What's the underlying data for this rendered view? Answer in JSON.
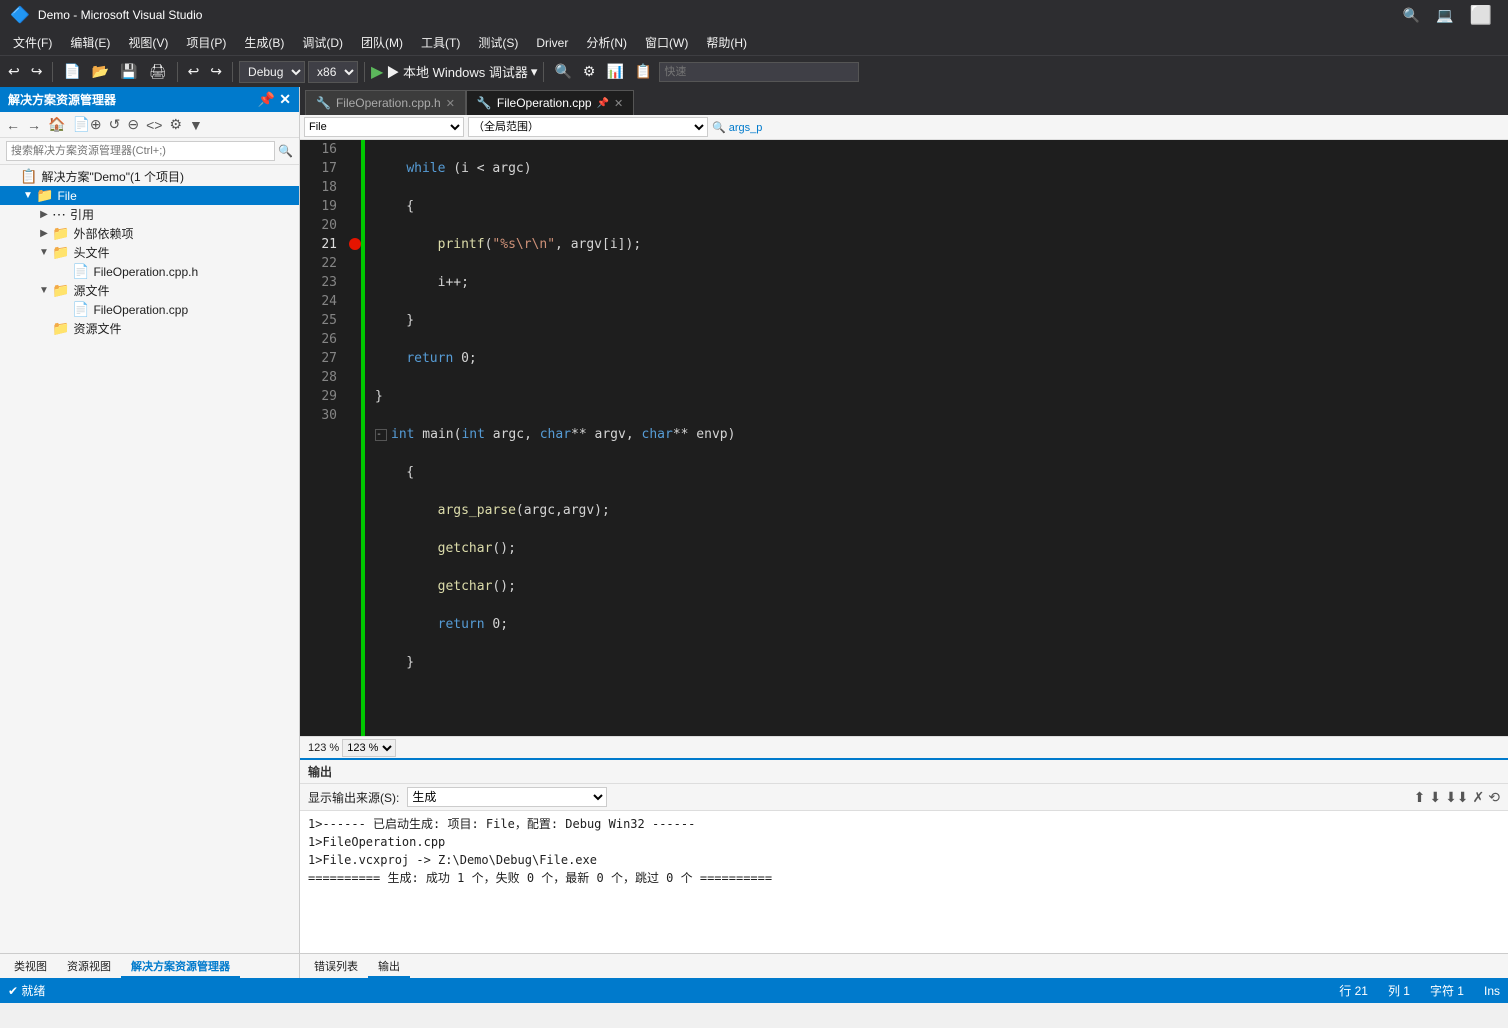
{
  "titleBar": {
    "icon": "🔷",
    "title": "Demo - Microsoft Visual Studio",
    "controls": [
      "🔍",
      "💻",
      "⬜"
    ]
  },
  "menuBar": {
    "items": [
      "文件(F)",
      "编辑(E)",
      "视图(V)",
      "项目(P)",
      "生成(B)",
      "调试(D)",
      "团队(M)",
      "工具(T)",
      "测试(S)",
      "Driver",
      "分析(N)",
      "窗口(W)",
      "帮助(H)"
    ]
  },
  "toolbar": {
    "debug_config": "Debug",
    "platform": "x86",
    "run_label": "▶  本地 Windows 调试器",
    "search_placeholder": "快速"
  },
  "sidebar": {
    "title": "解决方案资源管理器",
    "search_placeholder": "搜索解决方案资源管理器(Ctrl+;)",
    "tree": [
      {
        "id": "solution",
        "label": "解决方案\"Demo\"(1 个项目)",
        "indent": 0,
        "icon": "📋",
        "arrow": "",
        "selected": false
      },
      {
        "id": "file-project",
        "label": "File",
        "indent": 1,
        "icon": "📁",
        "arrow": "▼",
        "selected": true
      },
      {
        "id": "references",
        "label": "引用",
        "indent": 2,
        "icon": "📦",
        "arrow": "▶",
        "selected": false
      },
      {
        "id": "external-deps",
        "label": "外部依赖项",
        "indent": 2,
        "icon": "📁",
        "arrow": "▶",
        "selected": false
      },
      {
        "id": "headers",
        "label": "头文件",
        "indent": 2,
        "icon": "📁",
        "arrow": "▼",
        "selected": false
      },
      {
        "id": "file-op-h",
        "label": "FileOperation.cpp.h",
        "indent": 3,
        "icon": "📄",
        "arrow": "",
        "selected": false
      },
      {
        "id": "source-files",
        "label": "源文件",
        "indent": 2,
        "icon": "📁",
        "arrow": "▼",
        "selected": false
      },
      {
        "id": "file-op-cpp",
        "label": "FileOperation.cpp",
        "indent": 3,
        "icon": "📄",
        "arrow": "",
        "selected": false
      },
      {
        "id": "resources",
        "label": "资源文件",
        "indent": 2,
        "icon": "📁",
        "arrow": "",
        "selected": false
      }
    ],
    "bottomTabs": [
      "类视图",
      "资源视图",
      "解决方案资源管理器"
    ]
  },
  "editor": {
    "tabs": [
      {
        "id": "tab-h",
        "label": "FileOperation.cpp.h",
        "icon": "🔧",
        "active": false,
        "pinned": false
      },
      {
        "id": "tab-cpp",
        "label": "FileOperation.cpp",
        "icon": "🔧",
        "active": true,
        "pinned": true
      }
    ],
    "fileDropdown": "File",
    "scopeDropdown": "（全局范围）",
    "symbolDropdown": "args_p",
    "zoom": "123 %",
    "lines": [
      {
        "num": 16,
        "content": "    <kw-blue>while</kw-blue> (i < argc)",
        "collapse": false,
        "breakpoint": false
      },
      {
        "num": 17,
        "content": "    {",
        "collapse": false,
        "breakpoint": false
      },
      {
        "num": 18,
        "content": "        <kw-yellow>printf</kw-yellow>(<kw-orange>\"%s\\r\\n\"</kw-orange>, argv[i]);",
        "collapse": false,
        "breakpoint": false
      },
      {
        "num": 19,
        "content": "        i++;",
        "collapse": false,
        "breakpoint": false
      },
      {
        "num": 20,
        "content": "    }",
        "collapse": false,
        "breakpoint": false
      },
      {
        "num": 21,
        "content": "    <kw-blue>return</kw-blue> 0;",
        "collapse": false,
        "breakpoint": true
      },
      {
        "num": 22,
        "content": "}",
        "collapse": false,
        "breakpoint": false
      },
      {
        "num": 23,
        "content": "<span class='collapse-marker'>-</span><kw-blue>int</kw-blue> main(<kw-blue>int</kw-blue> argc, <kw-blue>char</kw-blue>** argv, <kw-blue>char</kw-blue>** envp)",
        "collapse": true,
        "breakpoint": false
      },
      {
        "num": 24,
        "content": "    {",
        "collapse": false,
        "breakpoint": false
      },
      {
        "num": 25,
        "content": "        <kw-yellow>args_parse</kw-yellow>(argc,argv);",
        "collapse": false,
        "breakpoint": false
      },
      {
        "num": 26,
        "content": "        <kw-yellow>getchar</kw-yellow>();",
        "collapse": false,
        "breakpoint": false
      },
      {
        "num": 27,
        "content": "        <kw-yellow>getchar</kw-yellow>();",
        "collapse": false,
        "breakpoint": false
      },
      {
        "num": 28,
        "content": "        <kw-blue>return</kw-blue> 0;",
        "collapse": false,
        "breakpoint": false
      },
      {
        "num": 29,
        "content": "    }",
        "collapse": false,
        "breakpoint": false
      },
      {
        "num": 30,
        "content": "",
        "collapse": false,
        "breakpoint": false
      }
    ]
  },
  "output": {
    "title": "输出",
    "sourceLabel": "显示输出来源(S):",
    "sourceValue": "生成",
    "lines": [
      "  1>------  已启动生成:  项目: File，配置: Debug Win32 ------",
      "  1>FileOperation.cpp",
      "  1>File.vcxproj -> Z:\\Demo\\Debug\\File.exe",
      "  ========== 生成: 成功 1 个，失败 0 个，最新 0 个，跳过 0 个 =========="
    ],
    "bottomTabs": [
      "错误列表",
      "输出"
    ]
  },
  "statusBar": {
    "ready": "✔  就绪",
    "row": "行 21",
    "col": "列 1",
    "char": "字符 1",
    "mode": "Ins"
  }
}
